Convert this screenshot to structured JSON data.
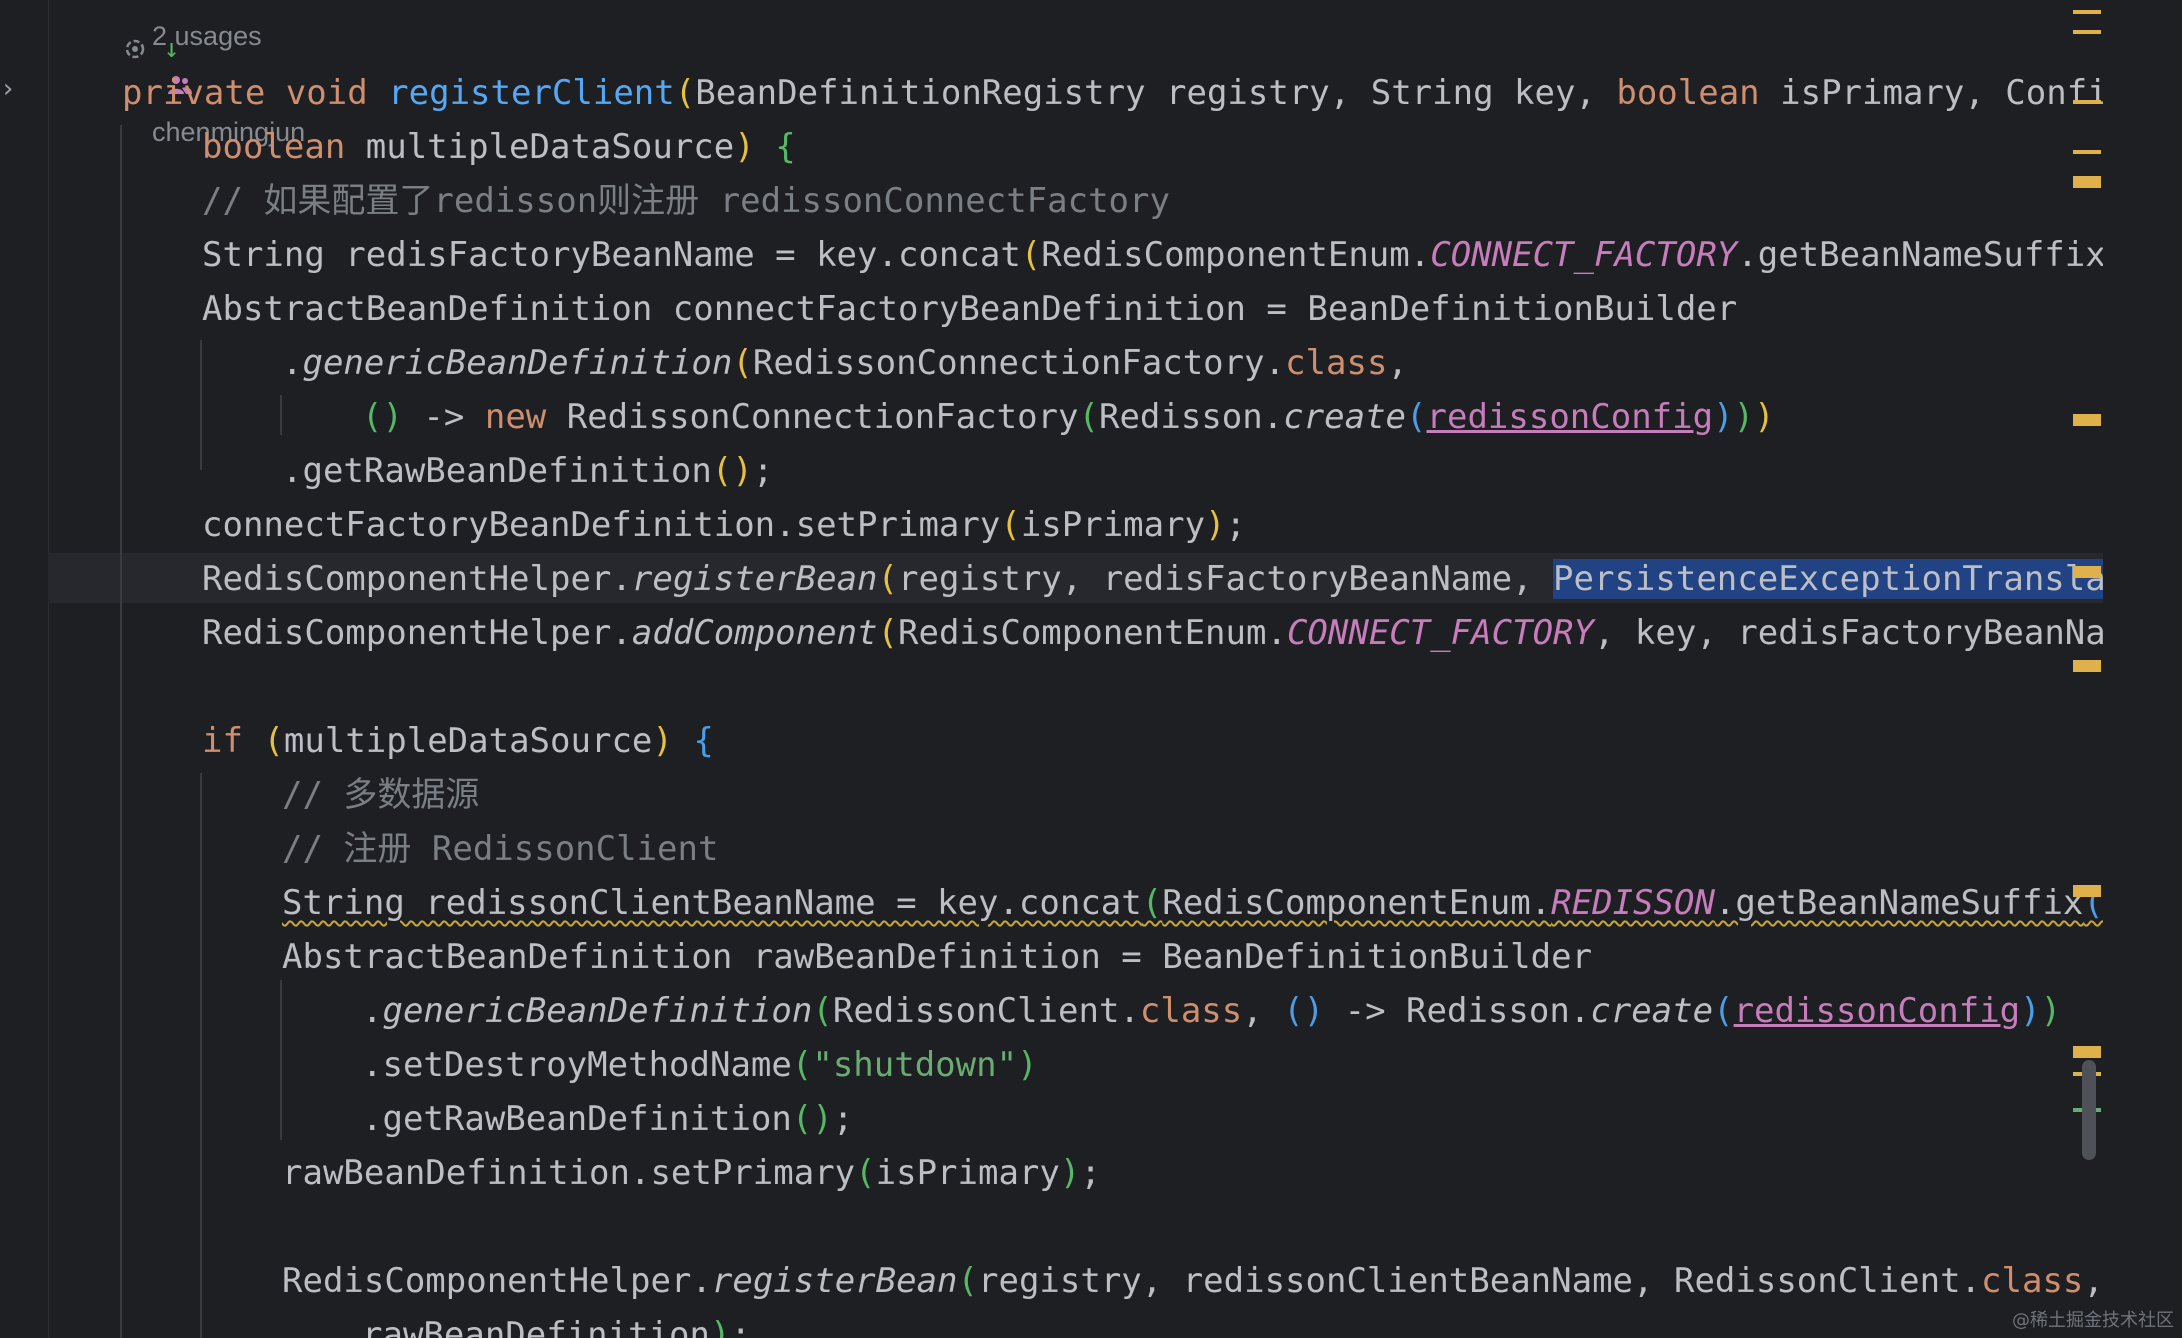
{
  "editor": {
    "inlay": {
      "usages": "2 usages",
      "author": "chenmingjun",
      "author_icon": "users-icon",
      "action_icon": "ai-assist-icon",
      "arrow": "↓"
    },
    "lines": [
      {
        "indent": 0,
        "tokens": [
          {
            "t": "private",
            "c": "kw"
          },
          {
            "t": " "
          },
          {
            "t": "void",
            "c": "kw"
          },
          {
            "t": " "
          },
          {
            "t": "registerClient",
            "c": "fn"
          },
          {
            "t": "(",
            "c": "b1"
          },
          {
            "t": "BeanDefinitionRegistry registry, String key, "
          },
          {
            "t": "boolean",
            "c": "kw"
          },
          {
            "t": " isPrimary, Config"
          }
        ]
      },
      {
        "indent": 1,
        "tokens": [
          {
            "t": "boolean",
            "c": "kw"
          },
          {
            "t": " multipleDataSource"
          },
          {
            "t": ")",
            "c": "b1"
          },
          {
            "t": " "
          },
          {
            "t": "{",
            "c": "b2"
          }
        ]
      },
      {
        "indent": 1,
        "tokens": [
          {
            "t": "// 如果配置了redisson则注册 redissonConnectFactory",
            "c": "cm"
          }
        ]
      },
      {
        "indent": 1,
        "tokens": [
          {
            "t": "String redisFactoryBeanName = key.concat"
          },
          {
            "t": "(",
            "c": "b1"
          },
          {
            "t": "RedisComponentEnum."
          },
          {
            "t": "CONNECT_FACTORY",
            "c": "const"
          },
          {
            "t": ".getBeanNameSuffix"
          },
          {
            "t": "()",
            "c": "b2"
          }
        ]
      },
      {
        "indent": 1,
        "tokens": [
          {
            "t": "AbstractBeanDefinition connectFactoryBeanDefinition = BeanDefinitionBuilder"
          }
        ]
      },
      {
        "indent": 2,
        "tokens": [
          {
            "t": "."
          },
          {
            "t": "genericBeanDefinition",
            "c": "it"
          },
          {
            "t": "(",
            "c": "b1"
          },
          {
            "t": "RedissonConnectionFactory."
          },
          {
            "t": "class",
            "c": "kw"
          },
          {
            "t": ","
          }
        ]
      },
      {
        "indent": 3,
        "tokens": [
          {
            "t": "()",
            "c": "b2"
          },
          {
            "t": " -> "
          },
          {
            "t": "new",
            "c": "kw"
          },
          {
            "t": " RedissonConnectionFactory"
          },
          {
            "t": "(",
            "c": "b2"
          },
          {
            "t": "Redisson."
          },
          {
            "t": "create",
            "c": "it"
          },
          {
            "t": "(",
            "c": "b3"
          },
          {
            "t": "redissonConfig",
            "c": "fld"
          },
          {
            "t": ")",
            "c": "b3"
          },
          {
            "t": ")",
            "c": "b2"
          },
          {
            "t": ")",
            "c": "b1"
          }
        ]
      },
      {
        "indent": 2,
        "tokens": [
          {
            "t": ".getRawBeanDefinition"
          },
          {
            "t": "()",
            "c": "b1"
          },
          {
            "t": ";"
          }
        ]
      },
      {
        "indent": 1,
        "tokens": [
          {
            "t": "connectFactoryBeanDefinition.setPrimary"
          },
          {
            "t": "(",
            "c": "b1"
          },
          {
            "t": "isPrimary"
          },
          {
            "t": ")",
            "c": "b1"
          },
          {
            "t": ";"
          }
        ]
      },
      {
        "indent": 1,
        "tokens": [
          {
            "t": "RedisComponentHelper."
          },
          {
            "t": "registerBean",
            "c": "it"
          },
          {
            "t": "(",
            "c": "b1"
          },
          {
            "t": "registry, redisFactoryBeanName, "
          },
          {
            "t": "PersistenceExceptionTranslato",
            "c": "sel"
          }
        ]
      },
      {
        "indent": 1,
        "tokens": [
          {
            "t": "RedisComponentHelper."
          },
          {
            "t": "addComponent",
            "c": "it"
          },
          {
            "t": "(",
            "c": "b1"
          },
          {
            "t": "RedisComponentEnum."
          },
          {
            "t": "CONNECT_FACTORY",
            "c": "const"
          },
          {
            "t": ", key, redisFactoryBeanName"
          }
        ]
      },
      {
        "indent": 0,
        "tokens": []
      },
      {
        "indent": 1,
        "tokens": [
          {
            "t": "if",
            "c": "kw"
          },
          {
            "t": " "
          },
          {
            "t": "(",
            "c": "b1"
          },
          {
            "t": "multipleDataSource"
          },
          {
            "t": ")",
            "c": "b1"
          },
          {
            "t": " "
          },
          {
            "t": "{",
            "c": "b3"
          }
        ]
      },
      {
        "indent": 2,
        "tokens": [
          {
            "t": "// 多数据源",
            "c": "cm"
          }
        ]
      },
      {
        "indent": 2,
        "tokens": [
          {
            "t": "// 注册 RedissonClient",
            "c": "cm"
          }
        ]
      },
      {
        "indent": 2,
        "tokens": [
          {
            "t": "String redissonClientBeanName = key.concat",
            "c": "warn"
          },
          {
            "t": "(",
            "c": "b2 warn"
          },
          {
            "t": "RedisComponentEnum.",
            "c": "warn"
          },
          {
            "t": "REDISSON",
            "c": "const warn"
          },
          {
            "t": ".getBeanNameSuffix",
            "c": "warn"
          },
          {
            "t": "()",
            "c": "b3 warn"
          },
          {
            "t": ")",
            "c": "b2 warn"
          }
        ]
      },
      {
        "indent": 2,
        "tokens": [
          {
            "t": "AbstractBeanDefinition rawBeanDefinition = BeanDefinitionBuilder"
          }
        ]
      },
      {
        "indent": 3,
        "tokens": [
          {
            "t": "."
          },
          {
            "t": "genericBeanDefinition",
            "c": "it"
          },
          {
            "t": "(",
            "c": "b2"
          },
          {
            "t": "RedissonClient."
          },
          {
            "t": "class",
            "c": "kw"
          },
          {
            "t": ", "
          },
          {
            "t": "()",
            "c": "b3"
          },
          {
            "t": " -> Redisson."
          },
          {
            "t": "create",
            "c": "it"
          },
          {
            "t": "(",
            "c": "b3"
          },
          {
            "t": "redissonConfig",
            "c": "fld"
          },
          {
            "t": ")",
            "c": "b3"
          },
          {
            "t": ")",
            "c": "b2"
          }
        ]
      },
      {
        "indent": 3,
        "tokens": [
          {
            "t": ".setDestroyMethodName"
          },
          {
            "t": "(",
            "c": "b2"
          },
          {
            "t": "\"shutdown\"",
            "c": "str"
          },
          {
            "t": ")",
            "c": "b2"
          }
        ]
      },
      {
        "indent": 3,
        "tokens": [
          {
            "t": ".getRawBeanDefinition"
          },
          {
            "t": "()",
            "c": "b2"
          },
          {
            "t": ";"
          }
        ]
      },
      {
        "indent": 2,
        "tokens": [
          {
            "t": "rawBeanDefinition.setPrimary"
          },
          {
            "t": "(",
            "c": "b2"
          },
          {
            "t": "isPrimary"
          },
          {
            "t": ")",
            "c": "b2"
          },
          {
            "t": ";"
          }
        ]
      },
      {
        "indent": 0,
        "tokens": []
      },
      {
        "indent": 2,
        "tokens": [
          {
            "t": "RedisComponentHelper."
          },
          {
            "t": "registerBean",
            "c": "it"
          },
          {
            "t": "(",
            "c": "b2"
          },
          {
            "t": "registry, redissonClientBeanName, RedissonClient."
          },
          {
            "t": "class",
            "c": "kw"
          },
          {
            "t": ","
          }
        ]
      },
      {
        "indent": 3,
        "tokens": [
          {
            "t": "rawBeanDefinition"
          },
          {
            "t": ")",
            "c": "b2"
          },
          {
            "t": ";"
          }
        ]
      }
    ]
  },
  "colors": {
    "background": "#1e1f22",
    "keyword": "#cf8e6d",
    "method": "#56a8f5",
    "comment": "#7a7e85",
    "constant": "#c77dbb",
    "string": "#6aab73",
    "selection": "#214283",
    "warning_mark": "#e0b14a"
  },
  "watermark": "@稀土掘金技术社区"
}
